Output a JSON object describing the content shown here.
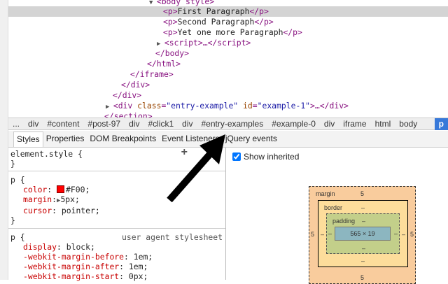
{
  "dom_tree": {
    "rows": [
      {
        "pre": "",
        "tag": "<body style>"
      },
      {
        "tag_open": "<p>",
        "text": "First Paragraph",
        "tag_close": "</p>"
      },
      {
        "tag_open": "<p>",
        "text": "Second Paragraph",
        "tag_close": "</p>"
      },
      {
        "tag_open": "<p>",
        "text": "Yet one more Paragraph",
        "tag_close": "</p>"
      },
      {
        "tag": "<script>…</script>"
      },
      {
        "tag": "</body>"
      },
      {
        "tag": "</html>"
      },
      {
        "tag": "</iframe>"
      },
      {
        "tag": "</div>"
      },
      {
        "tag": "</div>"
      },
      {
        "tag_open": "<div ",
        "attr1": "class",
        "val1": "\"entry-example\"",
        "attr2": "id",
        "val2": "\"example-1\"",
        "tag_close": ">…</div>"
      },
      {
        "tag": "</section>"
      }
    ]
  },
  "breadcrumbs": [
    "...",
    "div",
    "#content",
    "#post-97",
    "div",
    "#click1",
    "div",
    "#entry-examples",
    "#example-0",
    "div",
    "iframe",
    "html",
    "body",
    "p"
  ],
  "tabs": [
    "Styles",
    "Properties",
    "DOM Breakpoints",
    "Event Listeners",
    "jQuery events"
  ],
  "styles": {
    "element_style": {
      "selector": "element.style {",
      "close": "}",
      "add": "+"
    },
    "rule1": {
      "selector": "p {",
      "props": [
        {
          "name": "color",
          "value": "#F00;"
        },
        {
          "name": "margin",
          "value": "5px;"
        },
        {
          "name": "cursor",
          "value": "pointer;"
        }
      ],
      "close": "}",
      "swatch": "#ff0000"
    },
    "rule2": {
      "selector": "p {",
      "source": "user agent stylesheet",
      "props": [
        {
          "name": "display",
          "value": "block;"
        },
        {
          "name": "-webkit-margin-before",
          "value": "1em;"
        },
        {
          "name": "-webkit-margin-after",
          "value": "1em;"
        },
        {
          "name": "-webkit-margin-start",
          "value": "0px;"
        }
      ]
    }
  },
  "metrics": {
    "show_inherited": "Show inherited",
    "margin_label": "margin",
    "border_label": "border",
    "padding_label": "padding",
    "margin": {
      "top": "5",
      "right": "5",
      "bottom": "5",
      "left": "5"
    },
    "border": {
      "top": "–",
      "right": "–",
      "bottom": "–",
      "left": "–"
    },
    "padding": {
      "top": "–",
      "right": "–",
      "bottom": "–",
      "left": "–"
    },
    "content": "565 × 19"
  }
}
